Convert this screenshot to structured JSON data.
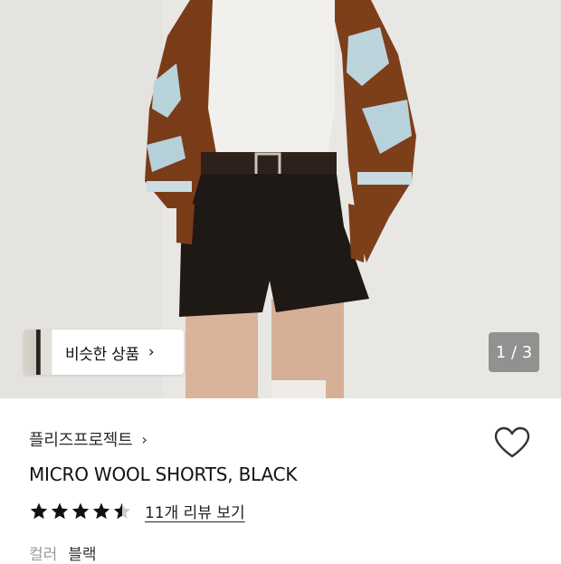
{
  "hero": {
    "image_icon": "product-photo",
    "similar_products": {
      "label": "비슷한 상품",
      "chevron": "›"
    },
    "page_counter": "1 / 3"
  },
  "product": {
    "brand": "플리즈프로젝트",
    "brand_chevron": "›",
    "title": "MICRO WOOL SHORTS, BLACK",
    "rating": {
      "stars": 4.5,
      "max": 5
    },
    "review_link": "11개 리뷰 보기",
    "option": {
      "label": "컬러",
      "value": "블랙"
    },
    "wishlist_icon": "heart-outline-icon"
  },
  "colors": {
    "background": "#ffffff",
    "photo_background": "#e9e8e5",
    "star": "#111111",
    "star_empty": "#cccccc",
    "counter_bg": "#787878"
  }
}
